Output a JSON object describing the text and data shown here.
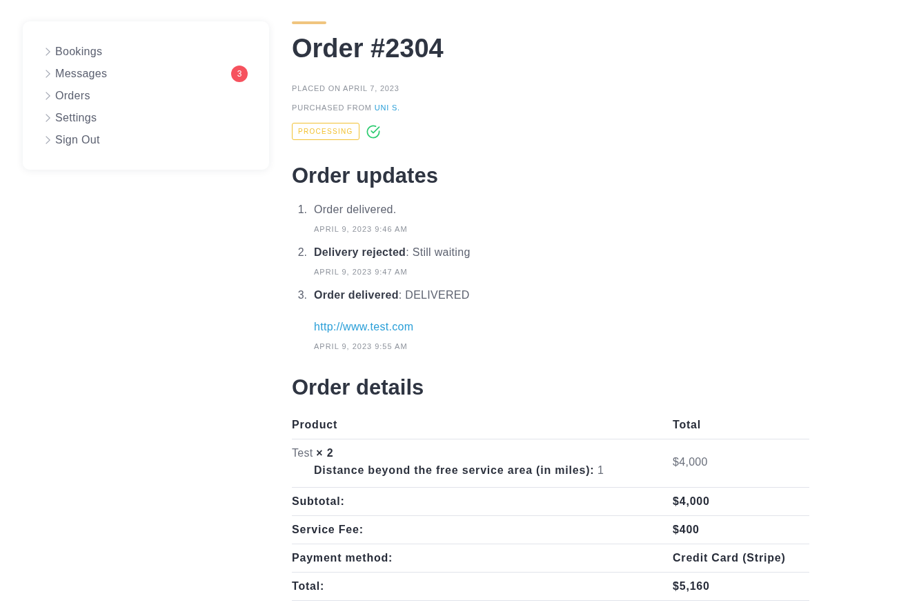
{
  "sidebar": {
    "items": [
      {
        "label": "Bookings"
      },
      {
        "label": "Messages",
        "badge": "3"
      },
      {
        "label": "Orders"
      },
      {
        "label": "Settings"
      },
      {
        "label": "Sign Out"
      }
    ]
  },
  "order": {
    "title": "Order #2304",
    "placed": "PLACED ON APRIL 7, 2023",
    "purchased_from": {
      "label": "PURCHASED FROM",
      "seller": "UNI S."
    },
    "status": {
      "label": "PROCESSING",
      "kind": "processing"
    },
    "verified": true
  },
  "updates": {
    "heading": "Order updates",
    "items": [
      {
        "number": "1.",
        "text": "Order delivered.",
        "date": "APRIL 9, 2023 9:46 AM"
      },
      {
        "number": "2.",
        "text": "**Delivery rejected**: Still waiting",
        "date": "APRIL 9, 2023 9:47 AM"
      },
      {
        "number": "3.",
        "text": "**Order delivered**: DELIVERED",
        "link": "http://www.test.com",
        "date": "APRIL 9, 2023 9:55 AM"
      }
    ]
  },
  "details": {
    "heading": "Order details",
    "columns": [
      "Product",
      "Total"
    ],
    "items": [
      {
        "product": "Test **× 2**",
        "meta": [
          "**Distance beyond the free service area (in miles):** 1"
        ],
        "total": "$4,000"
      }
    ],
    "totals": [
      {
        "label": "Subtotal:",
        "value": "$4,000"
      },
      {
        "label": "Service Fee:",
        "value": "$400"
      },
      {
        "label": "Payment method:",
        "value": "Credit Card (Stripe)"
      },
      {
        "label": "Total:",
        "value": "$5,160"
      }
    ]
  }
}
